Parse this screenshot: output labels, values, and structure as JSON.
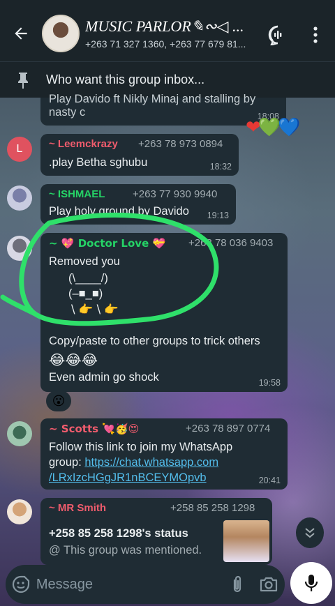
{
  "header": {
    "group_name": "MUSIC PARLOR✎∾◁ ...",
    "members": "+263 71 327 1360, +263 77 679 81..."
  },
  "pinned": {
    "text": "Who want this group inbox..."
  },
  "messages": [
    {
      "partial_text": "Play Davido ft Nikly Minaj and stalling by",
      "partial_text2": "nasty c",
      "time": "18:08"
    },
    {
      "avatar_letter": "L",
      "sender": "~ Leemckrazy",
      "phone": "+263 78 973 0894",
      "text": ".play Betha sghubu",
      "time": "18:32"
    },
    {
      "sender": "~ ISHMAEL",
      "phone": "+263 77 930 9940",
      "text": "Play holy ground by Davido",
      "time": "19:13"
    },
    {
      "sender": "~ 💖 Doctor Love 💝",
      "phone": "+263 78 036 9403",
      "lines": [
        "Removed you",
        "(\\____/)",
        "(–■_■)",
        "\\ 👉   \\ 👉"
      ],
      "line_copy": "Copy/paste to other groups to trick others",
      "line_emoji": "😂😂😂",
      "line_admin": "Even admin go shock",
      "time": "19:58",
      "reaction": "😮"
    },
    {
      "sender": "~ Scotts 💘🥳😍",
      "phone": "+263 78 897 0774",
      "text": "Follow this link to join my WhatsApp",
      "text2_prefix": "group: ",
      "link1": "https://chat.whatsapp.com",
      "link2": "/LRxIzcHGgJR1nBCEYMOpvb",
      "time": "20:41"
    },
    {
      "sender": "~ MR Smith",
      "phone": "+258 85 258 1298",
      "status_title": "+258 85 258 1298's status",
      "status_sub": "@ This group was mentioned."
    }
  ],
  "composer": {
    "placeholder": "Message"
  },
  "colors": {
    "header_bg": "#1b2429",
    "bubble_bg": "#1f2c34",
    "link": "#53bdeb",
    "sender_leem": "#f15c6d",
    "sender_ishmael": "#25d366",
    "sender_doctor": "#25d366",
    "sender_scotts": "#f15c6d",
    "sender_smith": "#f15c6d",
    "annotation": "#2fe06a"
  }
}
